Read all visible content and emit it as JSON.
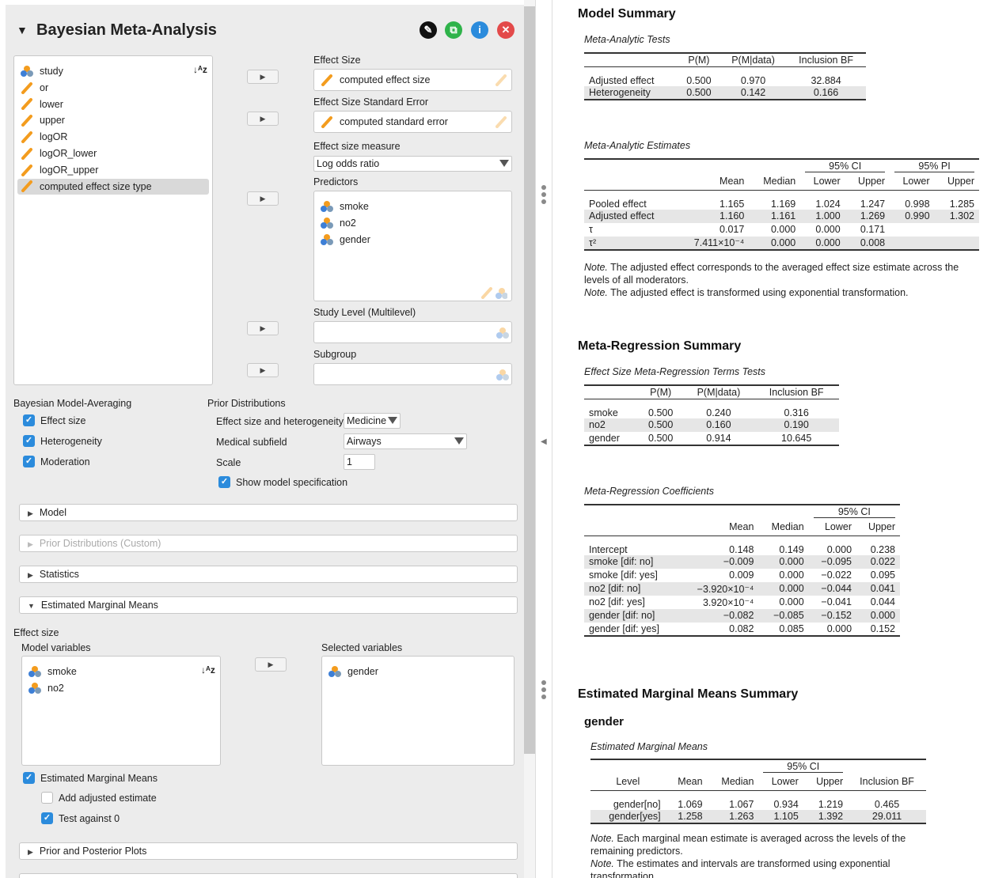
{
  "header": {
    "title": "Bayesian Meta-Analysis",
    "collapse_glyph": "▼"
  },
  "variables": [
    "study",
    "or",
    "lower",
    "upper",
    "logOR",
    "logOR_lower",
    "logOR_upper",
    "computed effect size type"
  ],
  "variable_icons": [
    "nominal",
    "scale",
    "scale",
    "scale",
    "scale",
    "scale",
    "scale",
    "scale"
  ],
  "effect_size": {
    "label": "Effect Size",
    "value": "computed effect size"
  },
  "effect_se": {
    "label": "Effect Size Standard Error",
    "value": "computed standard error"
  },
  "measure": {
    "label": "Effect size measure",
    "value": "Log odds ratio"
  },
  "predictors": {
    "label": "Predictors",
    "items": [
      "smoke",
      "no2",
      "gender"
    ]
  },
  "study_level": {
    "label": "Study Level (Multilevel)"
  },
  "subgroup": {
    "label": "Subgroup"
  },
  "bma": {
    "label": "Bayesian Model-Averaging",
    "items": [
      {
        "label": "Effect size",
        "checked": true
      },
      {
        "label": "Heterogeneity",
        "checked": true
      },
      {
        "label": "Moderation",
        "checked": true
      }
    ]
  },
  "priors": {
    "label": "Prior Distributions",
    "esh_label": "Effect size and heterogeneity",
    "esh_value": "Medicine",
    "sub_label": "Medical subfield",
    "sub_value": "Airways",
    "scale_label": "Scale",
    "scale_value": "1",
    "show_spec": "Show model specification"
  },
  "sections": {
    "model": "Model",
    "custom": "Prior Distributions (Custom)",
    "statistics": "Statistics",
    "emm": "Estimated Marginal Means",
    "plots": "Prior and Posterior Plots"
  },
  "emm_panel": {
    "effect_label": "Effect size",
    "model_vars_label": "Model variables",
    "model_vars": [
      "smoke",
      "no2"
    ],
    "selected_label": "Selected variables",
    "selected": [
      "gender"
    ],
    "emm_check": "Estimated Marginal Means",
    "adj_check": "Add adjusted estimate",
    "test_check": "Test against 0"
  },
  "out": {
    "model_summary": "Model Summary",
    "tests_cap": "Meta-Analytic Tests",
    "tests_hdr": [
      "P(M)",
      "P(M|data)",
      "Inclusion BF"
    ],
    "tests_rows": [
      [
        "Adjusted effect",
        "0.500",
        "0.970",
        "32.884"
      ],
      [
        "Heterogeneity",
        "0.500",
        "0.142",
        "0.166"
      ]
    ],
    "est_cap": "Meta-Analytic Estimates",
    "est_span": [
      "95% CI",
      "95% PI"
    ],
    "est_hdr": [
      "Mean",
      "Median",
      "Lower",
      "Upper",
      "Lower",
      "Upper"
    ],
    "est_rows": [
      [
        "Pooled effect",
        "1.165",
        "1.169",
        "1.024",
        "1.247",
        "0.998",
        "1.285"
      ],
      [
        "Adjusted effect",
        "1.160",
        "1.161",
        "1.000",
        "1.269",
        "0.990",
        "1.302"
      ],
      [
        "τ",
        "0.017",
        "0.000",
        "0.000",
        "0.171",
        "",
        ""
      ],
      [
        "τ²",
        "7.411×10⁻⁴",
        "0.000",
        "0.000",
        "0.008",
        "",
        ""
      ]
    ],
    "est_note1": "The adjusted effect corresponds to the averaged effect size estimate across the levels of all moderators.",
    "est_note2": "The adjusted effect is transformed using exponential transformation.",
    "note_word": "Note.",
    "mr_summary": "Meta-Regression Summary",
    "mrt_cap": "Effect Size Meta-Regression Terms Tests",
    "mrt_hdr": [
      "P(M)",
      "P(M|data)",
      "Inclusion BF"
    ],
    "mrt_rows": [
      [
        "smoke",
        "0.500",
        "0.240",
        "0.316"
      ],
      [
        "no2",
        "0.500",
        "0.160",
        "0.190"
      ],
      [
        "gender",
        "0.500",
        "0.914",
        "10.645"
      ]
    ],
    "mrc_cap": "Meta-Regression Coefficients",
    "mrc_span": "95% CI",
    "mrc_hdr": [
      "Mean",
      "Median",
      "Lower",
      "Upper"
    ],
    "mrc_rows": [
      [
        "Intercept",
        "0.148",
        "0.149",
        "0.000",
        "0.238"
      ],
      [
        "smoke [dif: no]",
        "−0.009",
        "0.000",
        "−0.095",
        "0.022"
      ],
      [
        "smoke [dif: yes]",
        "0.009",
        "0.000",
        "−0.022",
        "0.095"
      ],
      [
        "no2 [dif: no]",
        "−3.920×10⁻⁴",
        "0.000",
        "−0.044",
        "0.041"
      ],
      [
        "no2 [dif: yes]",
        "3.920×10⁻⁴",
        "0.000",
        "−0.041",
        "0.044"
      ],
      [
        "gender [dif: no]",
        "−0.082",
        "−0.085",
        "−0.152",
        "0.000"
      ],
      [
        "gender [dif: yes]",
        "0.082",
        "0.085",
        "0.000",
        "0.152"
      ]
    ],
    "emm_summary": "Estimated Marginal Means Summary",
    "emm_var": "gender",
    "emm_cap": "Estimated Marginal Means",
    "emm_span": "95% CI",
    "emm_hdr": [
      "Level",
      "Mean",
      "Median",
      "Lower",
      "Upper",
      "Inclusion BF"
    ],
    "emm_rows": [
      [
        "gender[no]",
        "1.069",
        "1.067",
        "0.934",
        "1.219",
        "0.465"
      ],
      [
        "gender[yes]",
        "1.258",
        "1.263",
        "1.105",
        "1.392",
        "29.011"
      ]
    ],
    "emm_note1": "Each marginal mean estimate is averaged across the levels of the remaining predictors.",
    "emm_note2": "The estimates and intervals are transformed using exponential transformation."
  },
  "colors": {
    "accent": "#2b8bdc",
    "scale_icon": "#f39c1e",
    "close": "#e34a4a",
    "copy": "#2fb34a",
    "info": "#2b8bdc"
  }
}
